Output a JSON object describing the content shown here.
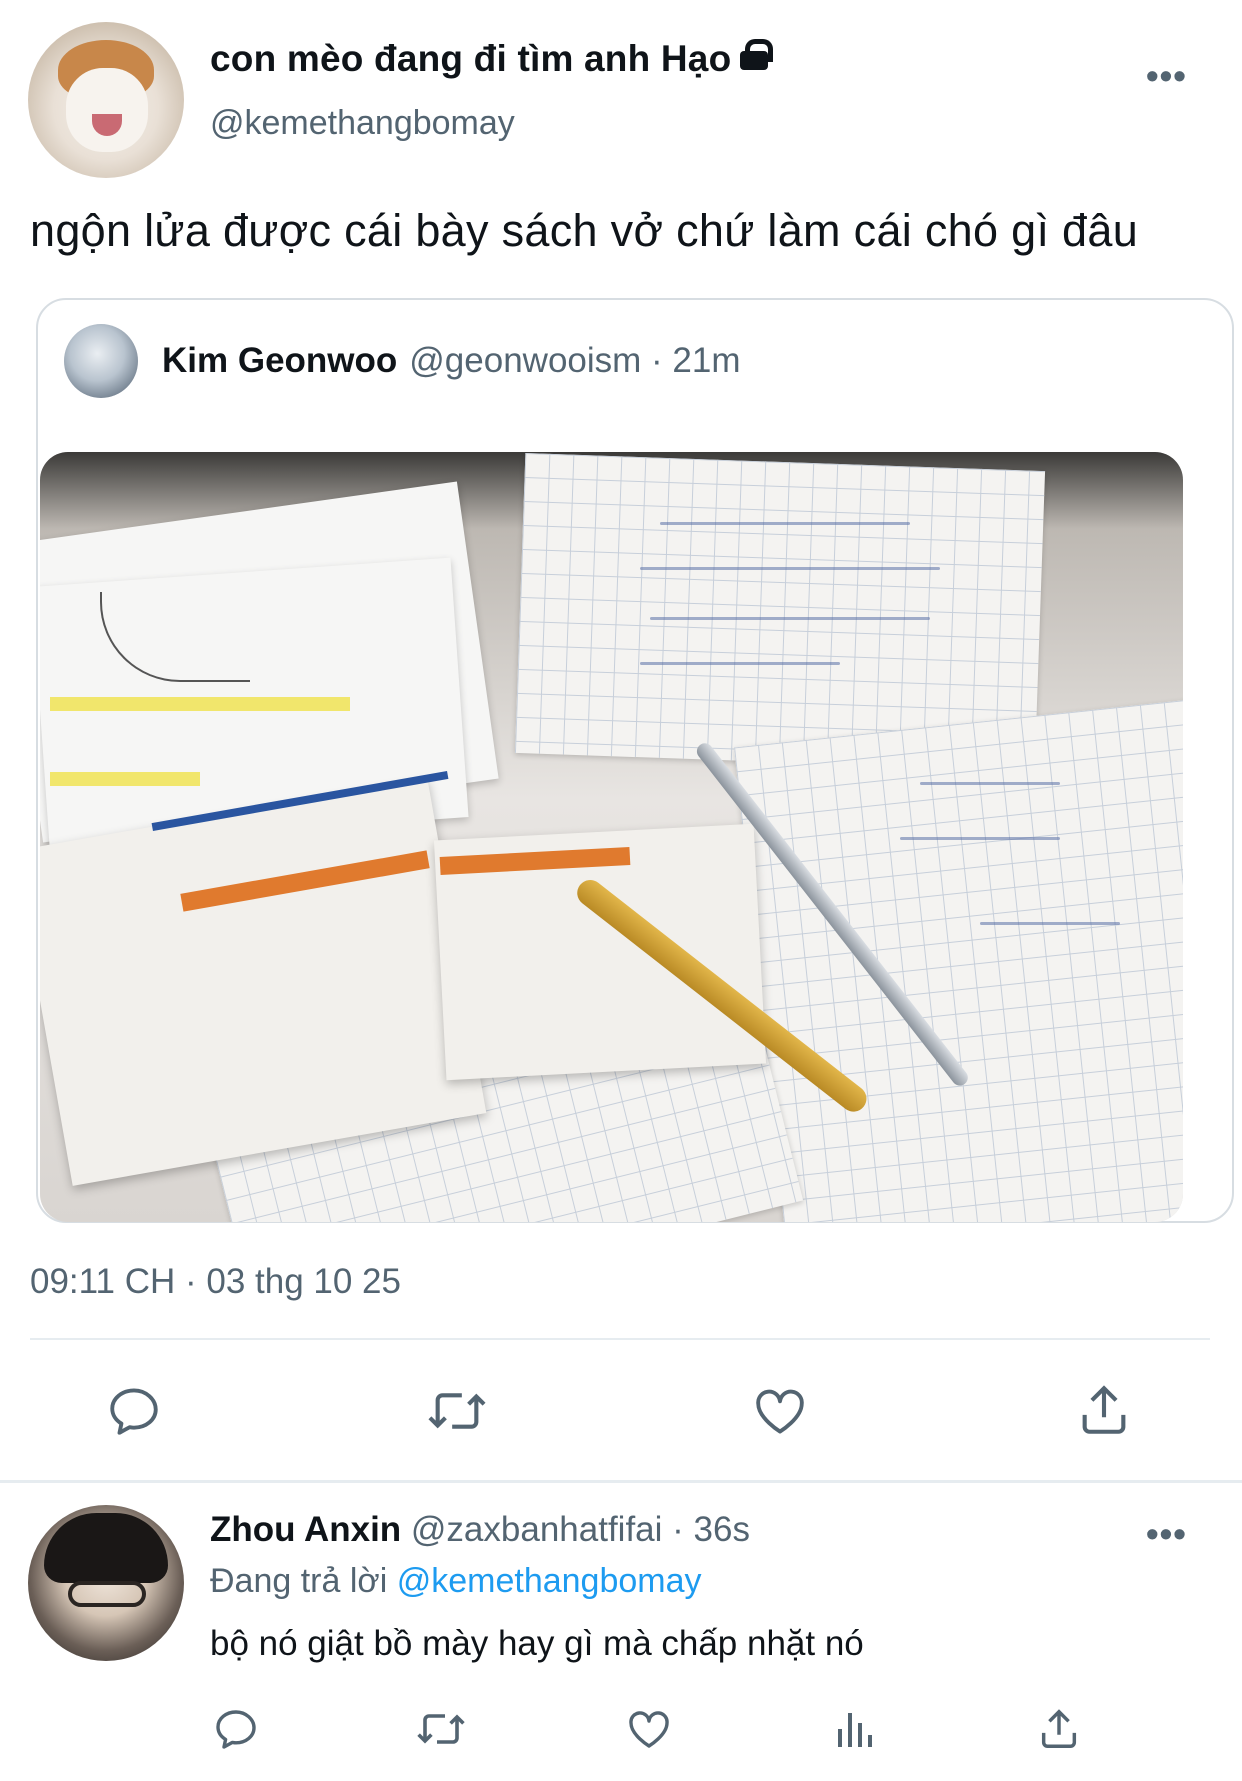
{
  "tweet": {
    "display_name": "con mèo đang đi tìm anh Hạo",
    "handle": "@kemethangbomay",
    "text": "ngộn lửa được cái bày sách vở chứ làm cái chó gì đâu",
    "timestamp": "09:11 CH · 03 thg 10 25",
    "more_label": "•••"
  },
  "quote": {
    "name": "Kim Geonwoo",
    "meta": "@geonwooism · 21m",
    "image_icon": "photo-of-notebooks-and-pencils"
  },
  "reply": {
    "name": "Zhou Anxin",
    "meta": "@zaxbanhatfifai · 36s",
    "replying_prefix": "Đang trả lời",
    "replying_to": "@kemethangbomay",
    "text": "bộ nó giật bồ mày hay gì mà chấp nhặt nó",
    "more_label": "•••"
  },
  "actions": {
    "main": [
      "reply-icon",
      "retweet-icon",
      "like-icon",
      "share-icon"
    ],
    "reply": [
      "reply-icon",
      "retweet-icon",
      "like-icon",
      "analytics-icon",
      "share-icon"
    ]
  },
  "colors": {
    "text": "#0f1419",
    "secondary": "#536471",
    "accent": "#1d9bf0",
    "divider": "#e6ecf0"
  }
}
